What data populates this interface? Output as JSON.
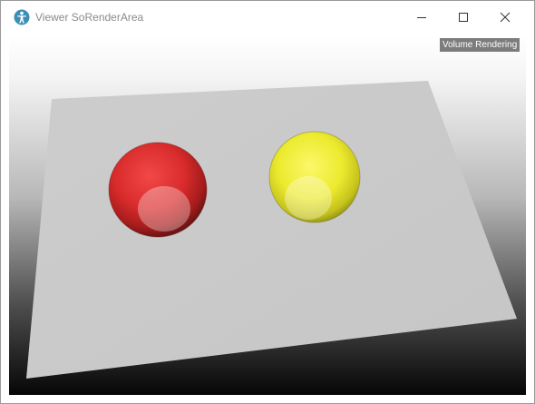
{
  "window": {
    "title": "Viewer SoRenderArea",
    "controls": {
      "minimize_icon": "minimize-icon",
      "maximize_icon": "maximize-icon",
      "close_icon": "close-icon"
    }
  },
  "viewer": {
    "overlay_label": "Volume Rendering",
    "background_gradient": [
      "#ffffff",
      "#000000"
    ],
    "plane_color": "#c8c8c8",
    "objects": [
      {
        "name": "red-sphere",
        "color": "#e02a2a"
      },
      {
        "name": "yellow-sphere",
        "color": "#f0ee32"
      }
    ]
  }
}
